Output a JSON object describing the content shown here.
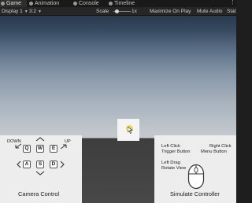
{
  "tabs": [
    {
      "label": "Game",
      "icon": "game-icon"
    },
    {
      "label": "Animation",
      "icon": "animation-icon"
    },
    {
      "label": "Console",
      "icon": "console-icon"
    },
    {
      "label": "Timeline",
      "icon": "timeline-icon"
    }
  ],
  "tab_menu": "⋮",
  "toolbar": {
    "display": "Display 1",
    "aspect": "3:2",
    "scale_label": "Scale",
    "scale_value": "1x",
    "scale_level": 0.1,
    "maximize": "Maximize On Play",
    "mute": "Mute Audio",
    "stats": "Stat"
  },
  "camera_panel": {
    "down_label": "DOWN",
    "up_label": "UP",
    "keys": [
      "Q",
      "W",
      "E",
      "A",
      "S",
      "D"
    ],
    "title": "Camera Control"
  },
  "controller_panel": {
    "left_click": "Left Click",
    "trigger_button": "Trigger Button",
    "right_click": "Right Click",
    "menu_button": "Menu Button",
    "left_drag": "Left Drag",
    "rotate_view": "Rotate View",
    "title": "Simulate Controller"
  },
  "colors": {
    "panel_bg": "#ededed",
    "editor_bg": "#262626",
    "pointer": "#f0d35a"
  }
}
